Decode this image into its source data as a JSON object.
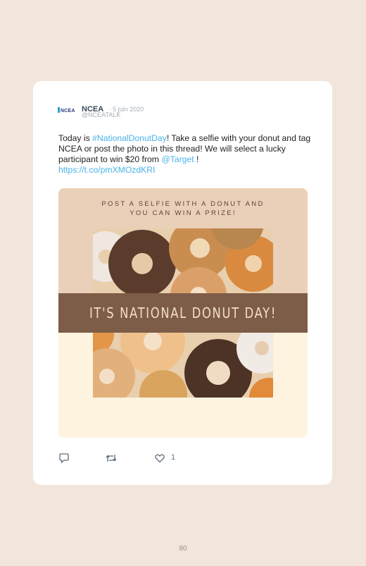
{
  "account": {
    "logo_text": "NCEA",
    "name": "NCEA",
    "date": "· 5 juin 2020",
    "handle": "@NCEATALK"
  },
  "tweet": {
    "part1": "Today is ",
    "hashtag": "#NationalDonutDay",
    "part2": "! Take a selfie with your donut and tag NCEA or post the photo in this thread! We will select a lucky participant to win $20 from ",
    "mention": "@Target",
    "part3": " !",
    "url": "https://t.co/pmXMOzdKRI"
  },
  "media": {
    "promo_line1": "POST A SELFIE WITH A DONUT AND",
    "promo_line2": "YOU CAN WIN A PRIZE!",
    "banner": "IT'S NATIONAL DONUT DAY!",
    "colors": {
      "top": "#ebd0b9",
      "bottom": "#fdf3df",
      "banner": "#7d5d47",
      "banner_text": "#f4ddc4"
    }
  },
  "actions": {
    "reply_icon": "reply-icon",
    "retweet_icon": "retweet-icon",
    "like_icon": "heart-icon",
    "like_count": "1"
  },
  "page": {
    "number": "80"
  }
}
